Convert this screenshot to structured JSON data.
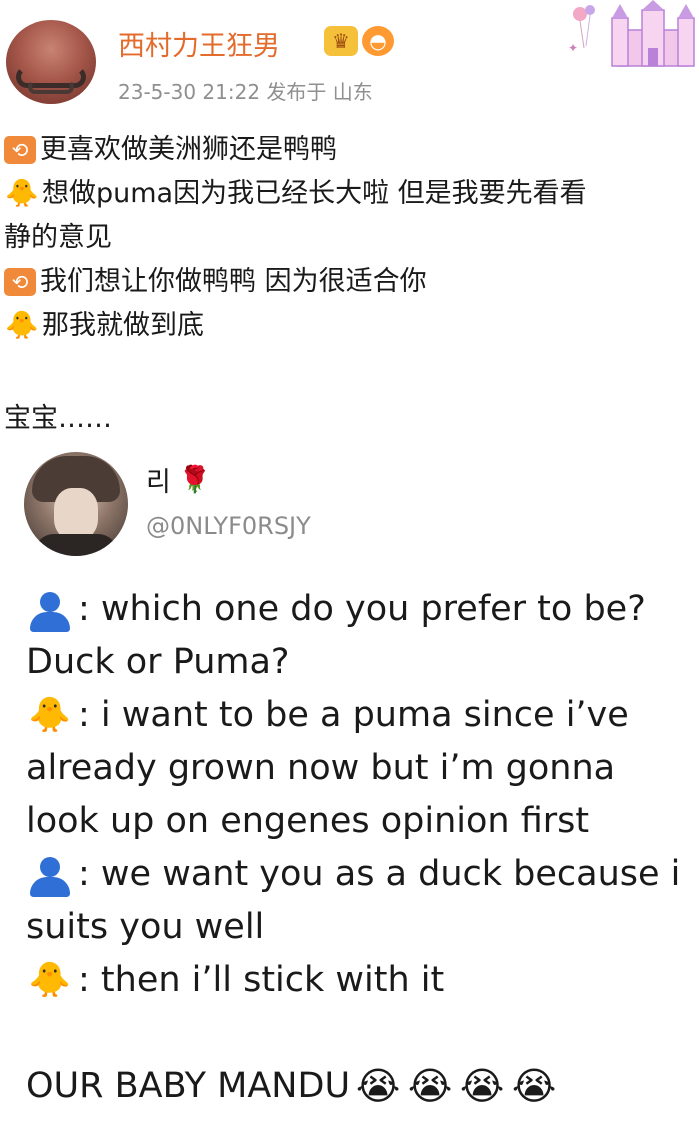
{
  "post": {
    "username": "西村力王狂男",
    "badges": [
      "crown-badge",
      "fish-badge"
    ],
    "meta": "23-5-30 21:22  发布于 山东",
    "lines": [
      {
        "icon": "repost-icon",
        "text": "更喜欢做美洲狮还是鸭鸭"
      },
      {
        "icon": "chick-icon",
        "text": "想做puma因为我已经长大啦 但是我要先看看",
        "cont": "静的意见"
      },
      {
        "icon": "repost-icon",
        "text": "我们想让你做鸭鸭 因为很适合你"
      },
      {
        "icon": "chick-icon",
        "text": "那我就做到底"
      }
    ],
    "tail": "宝宝……"
  },
  "tweet": {
    "name": "리",
    "handle": "@0NLYF0RSJY",
    "lines": [
      {
        "icon": "person-icon",
        "text": ": which one do you prefer to be?"
      },
      {
        "icon": "",
        "text": "Duck or Puma?"
      },
      {
        "icon": "chick-icon",
        "text": ": i want to be a puma since i’ve"
      },
      {
        "icon": "",
        "text": "already grown now but i’m gonna"
      },
      {
        "icon": "",
        "text": "look up on engenes opinion first"
      },
      {
        "icon": "person-icon",
        "text": ": we want you as a duck because i"
      },
      {
        "icon": "",
        "text": "suits you well"
      },
      {
        "icon": "chick-icon",
        "text": ": then i’ll stick with it"
      }
    ],
    "closing": "OUR BABY MANDU",
    "colors": {
      "accent": "#e36b2c",
      "person": "#2f6fd6",
      "rose": "#c8102e"
    }
  }
}
